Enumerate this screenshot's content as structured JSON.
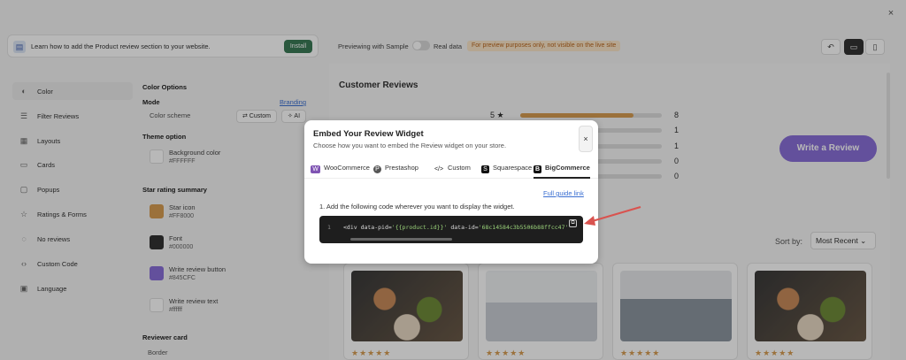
{
  "window": {
    "close_glyph": "×"
  },
  "banner": {
    "text": "Learn how to add the Product review section to your website.",
    "install_label": "Install",
    "icon": "book-icon"
  },
  "preview_bar": {
    "previewing_label": "Previewing with Sample",
    "real_data_label": "Real data",
    "note": "For preview purposes only, not visible on the live site",
    "undo_glyph": "↶",
    "desktop_glyph": "▭",
    "mobile_glyph": "▯"
  },
  "sidebar": {
    "items": [
      {
        "label": "Color",
        "icon": "palette-icon",
        "glyph": "◐",
        "active": true
      },
      {
        "label": "Filter Reviews",
        "icon": "filter-icon",
        "glyph": "☰"
      },
      {
        "label": "Layouts",
        "icon": "layout-icon",
        "glyph": "▦"
      },
      {
        "label": "Cards",
        "icon": "card-icon",
        "glyph": "▭"
      },
      {
        "label": "Popups",
        "icon": "popup-icon",
        "glyph": "▢"
      },
      {
        "label": "Ratings & Forms",
        "icon": "star-icon",
        "glyph": "☆"
      },
      {
        "label": "No reviews",
        "icon": "empty-icon",
        "glyph": "◌"
      },
      {
        "label": "Custom Code",
        "icon": "code-icon",
        "glyph": "‹›"
      },
      {
        "label": "Language",
        "icon": "language-icon",
        "glyph": "▣"
      }
    ]
  },
  "settings": {
    "color_options": "Color Options",
    "mode": "Mode",
    "branding": "Branding",
    "color_scheme": "Color scheme",
    "custom_chip": "⇄ Custom",
    "ai_chip": "✧ AI",
    "theme_option": "Theme option",
    "star_summary": "Star rating summary",
    "reviewer_card": "Reviewer card",
    "border": "Border",
    "swatches": [
      {
        "name": "Background color",
        "hex": "#FFFFFF",
        "color": "#FFFFFF"
      },
      {
        "name": "Star icon",
        "hex": "#FF8000",
        "color": "#D79D52"
      },
      {
        "name": "Font",
        "hex": "#000000",
        "color": "#333333"
      },
      {
        "name": "Write review button",
        "hex": "#845CFC",
        "color": "#8A6FD8"
      },
      {
        "name": "Write review text",
        "hex": "#ffffff",
        "color": "#FFFFFF"
      }
    ]
  },
  "preview": {
    "title": "Customer Reviews",
    "ratings": [
      {
        "label": "5 ★",
        "count": "8",
        "fraction": 0.8
      },
      {
        "label": "",
        "count": "1",
        "fraction": 0
      },
      {
        "label": "",
        "count": "1",
        "fraction": 0
      },
      {
        "label": "",
        "count": "0",
        "fraction": 0
      },
      {
        "label": "",
        "count": "0",
        "fraction": 0
      }
    ],
    "write_review": "Write a Review",
    "sort_label": "Sort by:",
    "sort_value": "Most Recent ⌄",
    "stars": "★★★★★"
  },
  "modal": {
    "title": "Embed Your Review Widget",
    "subtitle": "Choose how you want to embed the Review widget on your store.",
    "close_glyph": "×",
    "tabs": [
      {
        "label": "WooCommerce",
        "icon": "woocommerce-icon",
        "glyph": "W",
        "color": "#7f54b3"
      },
      {
        "label": "Prestashop",
        "icon": "prestashop-icon",
        "glyph": "P",
        "color": "#555"
      },
      {
        "label": "Custom",
        "icon": "code-icon",
        "glyph": "</>",
        "color": ""
      },
      {
        "label": "Squarespace",
        "icon": "squarespace-icon",
        "glyph": "S",
        "color": "#111"
      },
      {
        "label": "BigCommerce",
        "icon": "bigcommerce-icon",
        "glyph": "B",
        "color": "#111",
        "active": true
      }
    ],
    "guide_link": "Full guide link",
    "step_text": "1. Add the following code wherever you want to display the widget.",
    "code_line_number": "1",
    "code_prefix": "<div data-pid=",
    "code_pid": "'{{product.id}}'",
    "code_mid": " data-id=",
    "code_id": "'68c14584c3b5506b88ffcc47'",
    "copy_glyph": "⧉"
  },
  "annotation": {
    "arrow_color": "#d9534f"
  }
}
